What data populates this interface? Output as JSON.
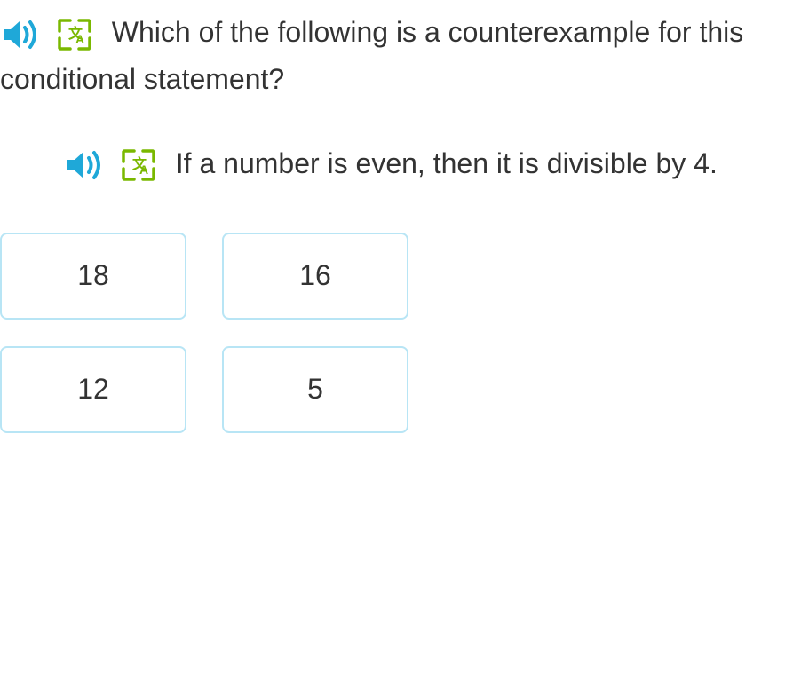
{
  "question": {
    "text": "Which of the following is a counterexample for this conditional statement?"
  },
  "statement": {
    "text": "If a number is even, then it is divisible by 4."
  },
  "answers": [
    {
      "label": "18"
    },
    {
      "label": "16"
    },
    {
      "label": "12"
    },
    {
      "label": "5"
    }
  ]
}
